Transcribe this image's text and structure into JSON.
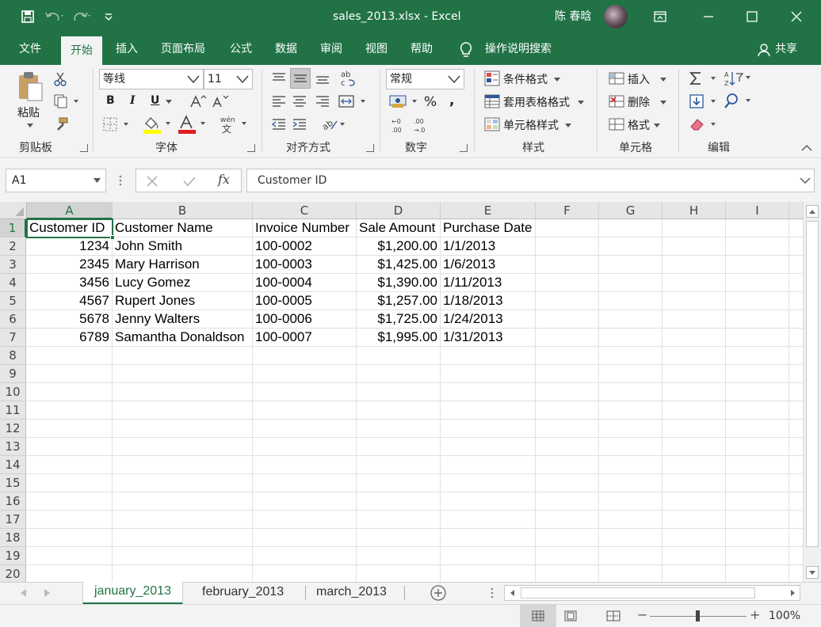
{
  "window": {
    "title": "sales_2013.xlsx  -  Excel",
    "user": "陈 春晗",
    "colors": {
      "brand": "#217346",
      "ribbon": "#f3f3f3"
    }
  },
  "menu": {
    "tabs": [
      "文件",
      "开始",
      "插入",
      "页面布局",
      "公式",
      "数据",
      "审阅",
      "视图",
      "帮助"
    ],
    "active": "开始",
    "tell_me": "操作说明搜索",
    "share": "共享"
  },
  "ribbon": {
    "clipboard": {
      "label": "剪贴板",
      "paste": "粘贴"
    },
    "font": {
      "label": "字体",
      "font_name": "等线",
      "font_size": "11",
      "bold": "B",
      "italic": "I",
      "underline": "U",
      "phonetic": "wén"
    },
    "alignment": {
      "label": "对齐方式"
    },
    "number": {
      "label": "数字",
      "format": "常规"
    },
    "styles": {
      "label": "样式",
      "conditional": "条件格式",
      "table": "套用表格格式",
      "cell_styles": "单元格样式"
    },
    "cells": {
      "label": "单元格",
      "insert": "插入",
      "delete": "删除",
      "format": "格式"
    },
    "editing": {
      "label": "编辑"
    }
  },
  "formula_bar": {
    "name_box": "A1",
    "formula": "Customer ID"
  },
  "grid": {
    "columns": [
      "A",
      "B",
      "C",
      "D",
      "E",
      "F",
      "G",
      "H",
      "I"
    ],
    "row_numbers": [
      "1",
      "2",
      "3",
      "4",
      "5",
      "6",
      "7",
      "8",
      "9",
      "10",
      "11",
      "12",
      "13",
      "14",
      "15",
      "16",
      "17",
      "18",
      "19",
      "20"
    ],
    "rows": [
      [
        "Customer ID",
        "Customer Name",
        "Invoice Number",
        "Sale Amount",
        "Purchase Date"
      ],
      [
        "1234",
        "John Smith",
        "100-0002",
        "$1,200.00",
        "1/1/2013"
      ],
      [
        "2345",
        "Mary Harrison",
        "100-0003",
        "$1,425.00",
        "1/6/2013"
      ],
      [
        "3456",
        "Lucy Gomez",
        "100-0004",
        "$1,390.00",
        "1/11/2013"
      ],
      [
        "4567",
        "Rupert Jones",
        "100-0005",
        "$1,257.00",
        "1/18/2013"
      ],
      [
        "5678",
        "Jenny Walters",
        "100-0006",
        "$1,725.00",
        "1/24/2013"
      ],
      [
        "6789",
        "Samantha Donaldson",
        "100-0007",
        "$1,995.00",
        "1/31/2013"
      ]
    ],
    "selected_cell": "A1"
  },
  "sheets": {
    "tabs": [
      "january_2013",
      "february_2013",
      "march_2013"
    ],
    "active": "january_2013"
  },
  "status": {
    "zoom": "100%"
  }
}
